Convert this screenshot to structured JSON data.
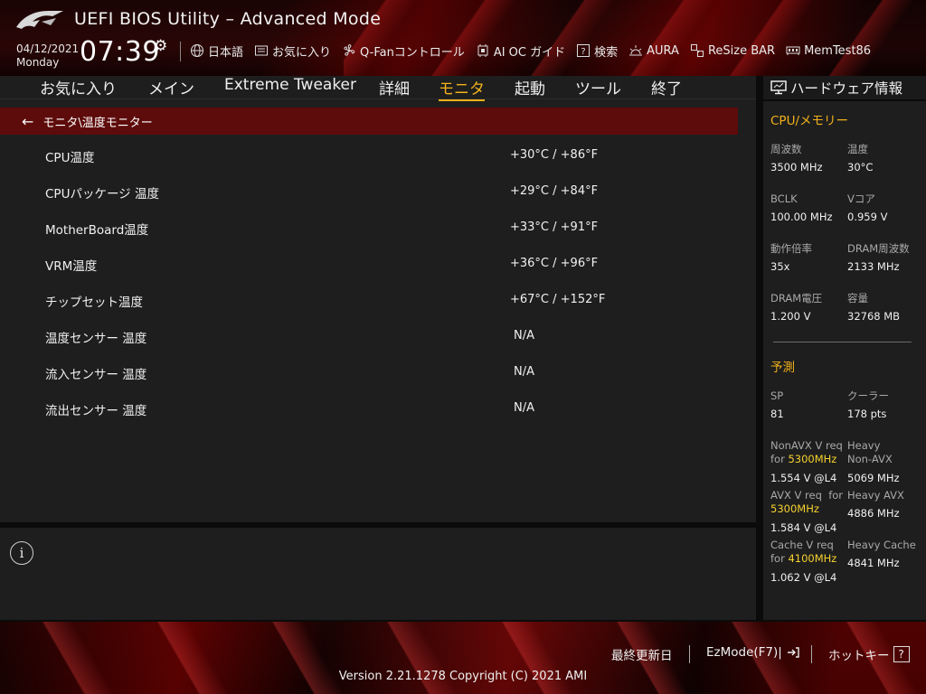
{
  "header": {
    "title": "UEFI BIOS Utility – Advanced Mode",
    "date": "04/12/2021",
    "weekday": "Monday",
    "time": "07:39",
    "toolbar": [
      {
        "label": "日本語",
        "icon": "globe-icon"
      },
      {
        "label": "お気に入り",
        "icon": "favorites-icon"
      },
      {
        "label": "Q-Fanコントロール",
        "icon": "fan-icon"
      },
      {
        "label": "AI OC ガイド",
        "icon": "ai-oc-icon"
      },
      {
        "label": "検索",
        "icon": "search-help-icon"
      },
      {
        "label": "AURA",
        "icon": "aura-icon"
      },
      {
        "label": "ReSize BAR",
        "icon": "resize-bar-icon"
      },
      {
        "label": "MemTest86",
        "icon": "memtest-icon"
      }
    ]
  },
  "tabs": [
    {
      "label": "お気に入り",
      "active": false
    },
    {
      "label": "メイン",
      "active": false
    },
    {
      "label": "Extreme Tweaker",
      "active": false
    },
    {
      "label": "詳細",
      "active": false
    },
    {
      "label": "モニタ",
      "active": true
    },
    {
      "label": "起動",
      "active": false
    },
    {
      "label": "ツール",
      "active": false
    },
    {
      "label": "終了",
      "active": false
    }
  ],
  "breadcrumb": "モニタ\\温度モニター",
  "monitor_rows": [
    {
      "label": "CPU温度",
      "value": "+30°C / +86°F"
    },
    {
      "label": "CPUパッケージ 温度",
      "value": "+29°C / +84°F"
    },
    {
      "label": "MotherBoard温度",
      "value": "+33°C / +91°F"
    },
    {
      "label": "VRM温度",
      "value": "+36°C / +96°F"
    },
    {
      "label": "チップセット温度",
      "value": "+67°C / +152°F"
    },
    {
      "label": "温度センサー 温度",
      "value": "N/A"
    },
    {
      "label": "流入センサー 温度",
      "value": "N/A"
    },
    {
      "label": "流出センサー 温度",
      "value": "N/A"
    }
  ],
  "hardware": {
    "title": "ハードウェア情報",
    "cpu_mem_title": "CPU/メモリー",
    "freq_label": "周波数",
    "freq_value": "3500 MHz",
    "temp_label": "温度",
    "temp_value": "30°C",
    "bclk_label": "BCLK",
    "bclk_value": "100.00 MHz",
    "vcore_label": "Vコア",
    "vcore_value": "0.959 V",
    "ratio_label": "動作倍率",
    "ratio_value": "35x",
    "dram_freq_label": "DRAM周波数",
    "dram_freq_value": "2133 MHz",
    "dram_volt_label": "DRAM電圧",
    "dram_volt_value": "1.200 V",
    "capacity_label": "容量",
    "capacity_value": "32768 MB",
    "prediction_title": "予測",
    "sp_label": "SP",
    "sp_value": "81",
    "cooler_label": "クーラー",
    "cooler_value": "178 pts",
    "nonavx_req_line1": "NonAVX V req",
    "nonavx_req_for": "for ",
    "nonavx_req_freq": "5300MHz",
    "nonavx_req_value": "1.554 V @L4",
    "heavy_nonavx_line1": "Heavy",
    "heavy_nonavx_line2": "Non-AVX",
    "heavy_nonavx_value": "5069 MHz",
    "avx_req_line1": "AVX V req",
    "avx_req_for": "for",
    "avx_req_freq": "5300MHz",
    "avx_req_value": "1.584 V @L4",
    "heavy_avx_label": "Heavy AVX",
    "heavy_avx_value": "4886 MHz",
    "cache_req_line1": "Cache V req",
    "cache_req_for": "for ",
    "cache_req_freq": "4100MHz",
    "cache_req_value": "1.062 V @L4",
    "heavy_cache_label": "Heavy Cache",
    "heavy_cache_value": "4841 MHz"
  },
  "footer": {
    "last_modified": "最終更新日",
    "ezmode": "EzMode(F7)|",
    "hotkeys": "ホットキー",
    "hotkeys_key": "?",
    "version": "Version 2.21.1278 Copyright (C) 2021 AMI"
  },
  "colors": {
    "accent": "#f2b11b",
    "highlight": "#f5d130",
    "breadcrumb_bg": "#5e0b0b",
    "panel_bg": "#1e1e1e"
  }
}
